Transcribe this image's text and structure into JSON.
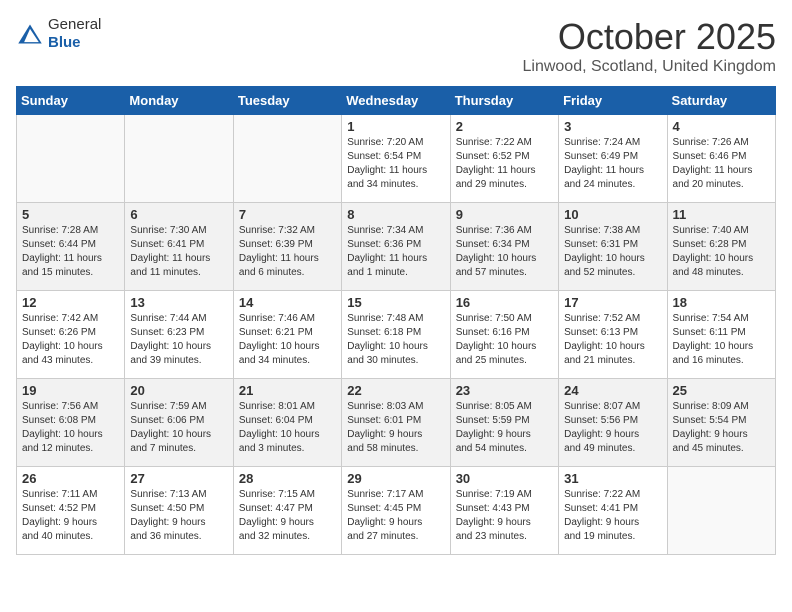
{
  "header": {
    "logo_general": "General",
    "logo_blue": "Blue",
    "month": "October 2025",
    "location": "Linwood, Scotland, United Kingdom"
  },
  "days_of_week": [
    "Sunday",
    "Monday",
    "Tuesday",
    "Wednesday",
    "Thursday",
    "Friday",
    "Saturday"
  ],
  "weeks": [
    [
      {
        "day": "",
        "info": ""
      },
      {
        "day": "",
        "info": ""
      },
      {
        "day": "",
        "info": ""
      },
      {
        "day": "1",
        "info": "Sunrise: 7:20 AM\nSunset: 6:54 PM\nDaylight: 11 hours\nand 34 minutes."
      },
      {
        "day": "2",
        "info": "Sunrise: 7:22 AM\nSunset: 6:52 PM\nDaylight: 11 hours\nand 29 minutes."
      },
      {
        "day": "3",
        "info": "Sunrise: 7:24 AM\nSunset: 6:49 PM\nDaylight: 11 hours\nand 24 minutes."
      },
      {
        "day": "4",
        "info": "Sunrise: 7:26 AM\nSunset: 6:46 PM\nDaylight: 11 hours\nand 20 minutes."
      }
    ],
    [
      {
        "day": "5",
        "info": "Sunrise: 7:28 AM\nSunset: 6:44 PM\nDaylight: 11 hours\nand 15 minutes."
      },
      {
        "day": "6",
        "info": "Sunrise: 7:30 AM\nSunset: 6:41 PM\nDaylight: 11 hours\nand 11 minutes."
      },
      {
        "day": "7",
        "info": "Sunrise: 7:32 AM\nSunset: 6:39 PM\nDaylight: 11 hours\nand 6 minutes."
      },
      {
        "day": "8",
        "info": "Sunrise: 7:34 AM\nSunset: 6:36 PM\nDaylight: 11 hours\nand 1 minute."
      },
      {
        "day": "9",
        "info": "Sunrise: 7:36 AM\nSunset: 6:34 PM\nDaylight: 10 hours\nand 57 minutes."
      },
      {
        "day": "10",
        "info": "Sunrise: 7:38 AM\nSunset: 6:31 PM\nDaylight: 10 hours\nand 52 minutes."
      },
      {
        "day": "11",
        "info": "Sunrise: 7:40 AM\nSunset: 6:28 PM\nDaylight: 10 hours\nand 48 minutes."
      }
    ],
    [
      {
        "day": "12",
        "info": "Sunrise: 7:42 AM\nSunset: 6:26 PM\nDaylight: 10 hours\nand 43 minutes."
      },
      {
        "day": "13",
        "info": "Sunrise: 7:44 AM\nSunset: 6:23 PM\nDaylight: 10 hours\nand 39 minutes."
      },
      {
        "day": "14",
        "info": "Sunrise: 7:46 AM\nSunset: 6:21 PM\nDaylight: 10 hours\nand 34 minutes."
      },
      {
        "day": "15",
        "info": "Sunrise: 7:48 AM\nSunset: 6:18 PM\nDaylight: 10 hours\nand 30 minutes."
      },
      {
        "day": "16",
        "info": "Sunrise: 7:50 AM\nSunset: 6:16 PM\nDaylight: 10 hours\nand 25 minutes."
      },
      {
        "day": "17",
        "info": "Sunrise: 7:52 AM\nSunset: 6:13 PM\nDaylight: 10 hours\nand 21 minutes."
      },
      {
        "day": "18",
        "info": "Sunrise: 7:54 AM\nSunset: 6:11 PM\nDaylight: 10 hours\nand 16 minutes."
      }
    ],
    [
      {
        "day": "19",
        "info": "Sunrise: 7:56 AM\nSunset: 6:08 PM\nDaylight: 10 hours\nand 12 minutes."
      },
      {
        "day": "20",
        "info": "Sunrise: 7:59 AM\nSunset: 6:06 PM\nDaylight: 10 hours\nand 7 minutes."
      },
      {
        "day": "21",
        "info": "Sunrise: 8:01 AM\nSunset: 6:04 PM\nDaylight: 10 hours\nand 3 minutes."
      },
      {
        "day": "22",
        "info": "Sunrise: 8:03 AM\nSunset: 6:01 PM\nDaylight: 9 hours\nand 58 minutes."
      },
      {
        "day": "23",
        "info": "Sunrise: 8:05 AM\nSunset: 5:59 PM\nDaylight: 9 hours\nand 54 minutes."
      },
      {
        "day": "24",
        "info": "Sunrise: 8:07 AM\nSunset: 5:56 PM\nDaylight: 9 hours\nand 49 minutes."
      },
      {
        "day": "25",
        "info": "Sunrise: 8:09 AM\nSunset: 5:54 PM\nDaylight: 9 hours\nand 45 minutes."
      }
    ],
    [
      {
        "day": "26",
        "info": "Sunrise: 7:11 AM\nSunset: 4:52 PM\nDaylight: 9 hours\nand 40 minutes."
      },
      {
        "day": "27",
        "info": "Sunrise: 7:13 AM\nSunset: 4:50 PM\nDaylight: 9 hours\nand 36 minutes."
      },
      {
        "day": "28",
        "info": "Sunrise: 7:15 AM\nSunset: 4:47 PM\nDaylight: 9 hours\nand 32 minutes."
      },
      {
        "day": "29",
        "info": "Sunrise: 7:17 AM\nSunset: 4:45 PM\nDaylight: 9 hours\nand 27 minutes."
      },
      {
        "day": "30",
        "info": "Sunrise: 7:19 AM\nSunset: 4:43 PM\nDaylight: 9 hours\nand 23 minutes."
      },
      {
        "day": "31",
        "info": "Sunrise: 7:22 AM\nSunset: 4:41 PM\nDaylight: 9 hours\nand 19 minutes."
      },
      {
        "day": "",
        "info": ""
      }
    ]
  ]
}
